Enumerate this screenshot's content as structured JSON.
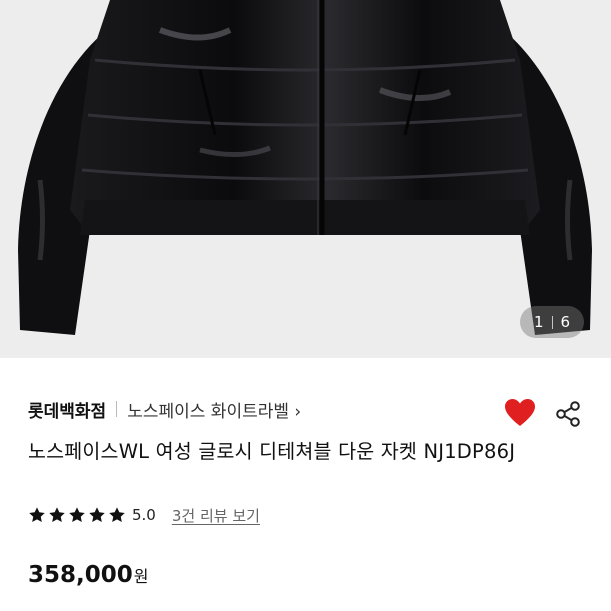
{
  "gallery": {
    "image_alt": "black glossy down jacket",
    "current": "1",
    "total": "6"
  },
  "product": {
    "brand": "롯데백화점",
    "sub_brand": "노스페이스 화이트라벨 ›",
    "title": "노스페이스WL 여성 글로시 디테쳐블 다운 자켓 NJ1DP86J",
    "rating": "5.0",
    "review_link": "3건 리뷰 보기",
    "price": "358,000",
    "currency": "원",
    "stars_filled": 5
  },
  "icons": {
    "favorite": "heart-icon",
    "share": "share-icon",
    "star": "star-icon"
  },
  "colors": {
    "heart": "#e02020",
    "jacket": "#0d0d0f",
    "background": "#ededee"
  }
}
